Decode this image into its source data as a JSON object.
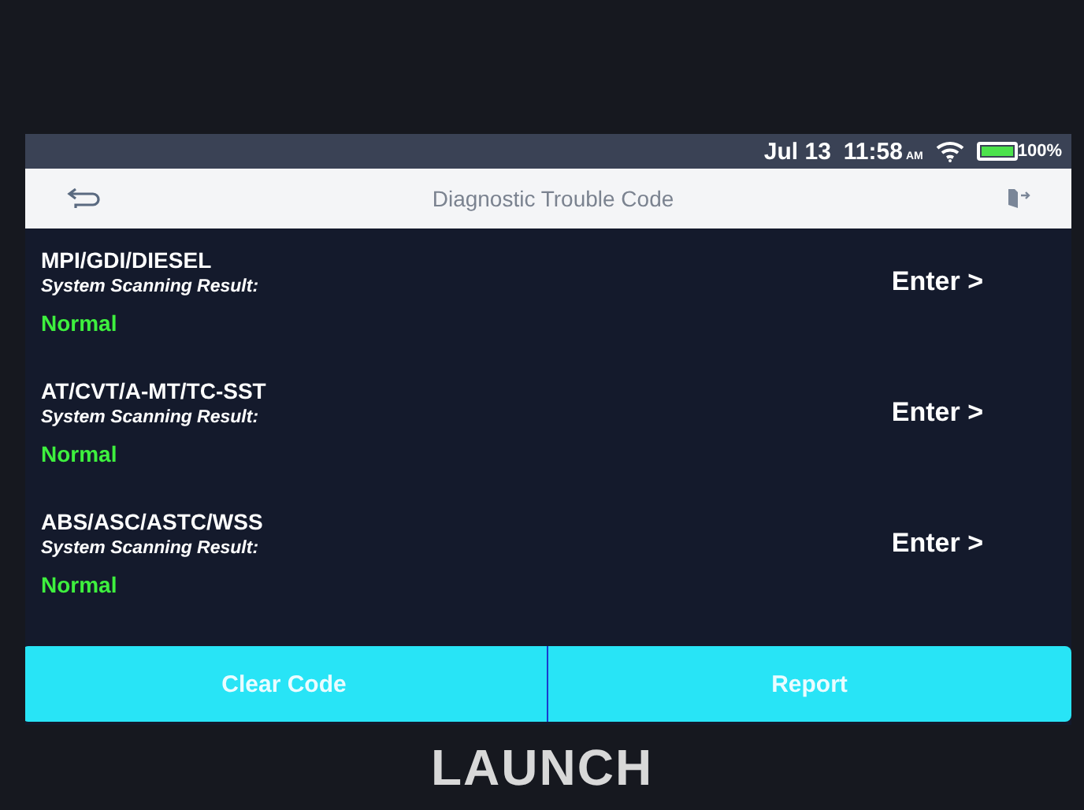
{
  "status_bar": {
    "date": "Jul 13",
    "time": "11:58",
    "meridiem": "AM",
    "battery": "100%"
  },
  "header": {
    "title": "Diagnostic Trouble Code"
  },
  "systems": [
    {
      "name": "MPI/GDI/DIESEL",
      "label": "System Scanning Result:",
      "result": "Normal",
      "action": "Enter >"
    },
    {
      "name": "AT/CVT/A-MT/TC-SST",
      "label": "System Scanning Result:",
      "result": "Normal",
      "action": "Enter >"
    },
    {
      "name": "ABS/ASC/ASTC/WSS",
      "label": "System Scanning Result:",
      "result": "Normal",
      "action": "Enter >"
    }
  ],
  "buttons": [
    "Clear Code",
    "Report"
  ],
  "brand": "LAUNCH"
}
